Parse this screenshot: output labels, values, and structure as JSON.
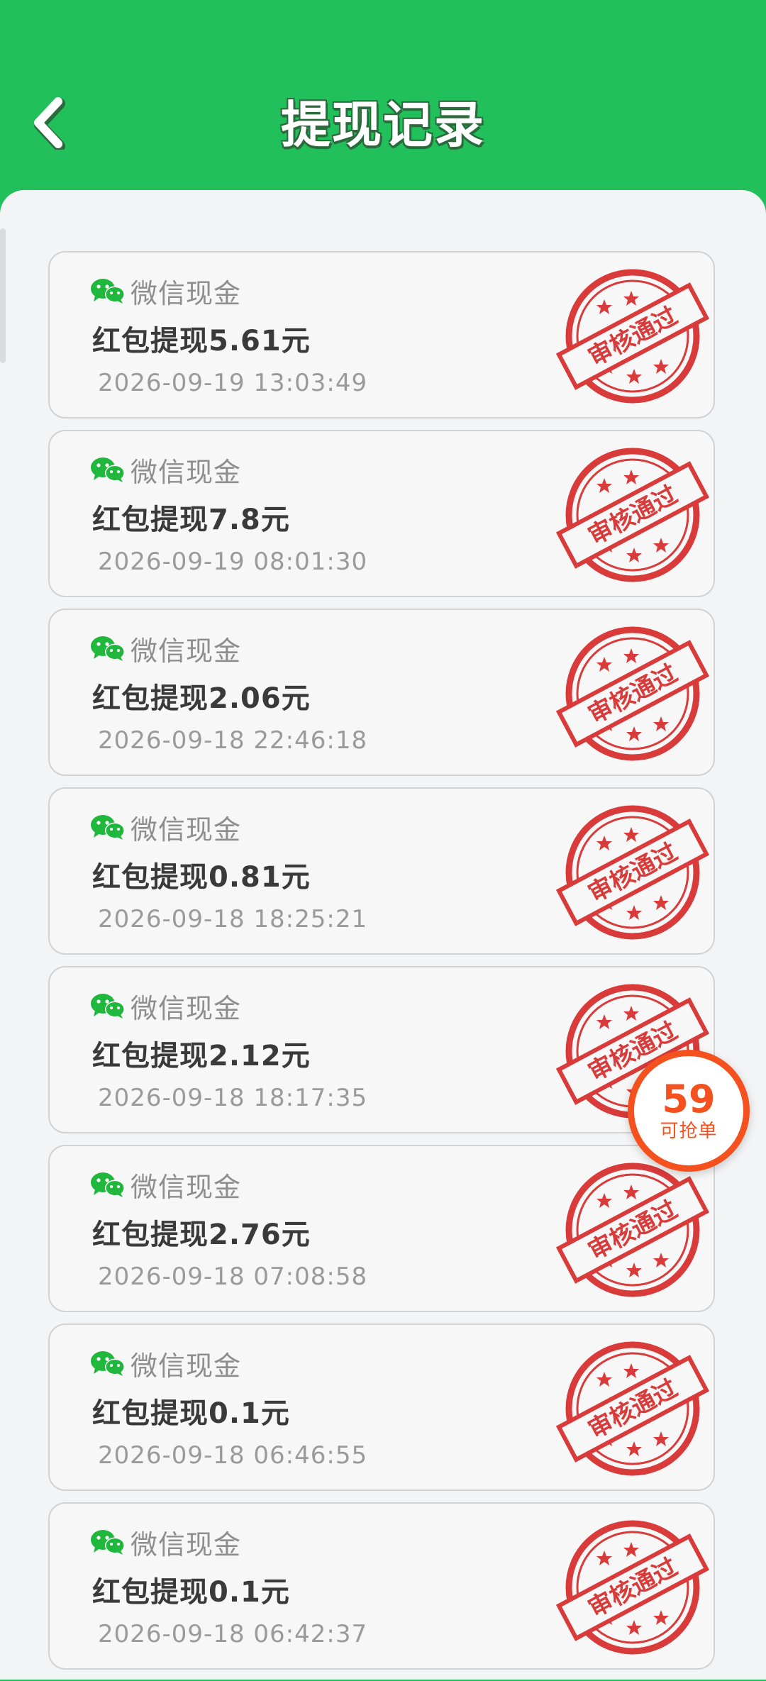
{
  "header": {
    "title": "提现记录",
    "back_icon": "chevron-left-icon"
  },
  "colors": {
    "header_bg": "#21c05b",
    "stamp_red": "#d93a3a",
    "wechat_green": "#1fb83d",
    "badge_orange": "#f4511e"
  },
  "records": [
    {
      "source": "微信现金",
      "title": "红包提现5.61元",
      "time": "2026-09-19 13:03:49",
      "stamp": "审核通过"
    },
    {
      "source": "微信现金",
      "title": "红包提现7.8元",
      "time": "2026-09-19 08:01:30",
      "stamp": "审核通过"
    },
    {
      "source": "微信现金",
      "title": "红包提现2.06元",
      "time": "2026-09-18 22:46:18",
      "stamp": "审核通过"
    },
    {
      "source": "微信现金",
      "title": "红包提现0.81元",
      "time": "2026-09-18 18:25:21",
      "stamp": "审核通过"
    },
    {
      "source": "微信现金",
      "title": "红包提现2.12元",
      "time": "2026-09-18 18:17:35",
      "stamp": "审核通过"
    },
    {
      "source": "微信现金",
      "title": "红包提现2.76元",
      "time": "2026-09-18 07:08:58",
      "stamp": "审核通过"
    },
    {
      "source": "微信现金",
      "title": "红包提现0.1元",
      "time": "2026-09-18 06:46:55",
      "stamp": "审核通过"
    },
    {
      "source": "微信现金",
      "title": "红包提现0.1元",
      "time": "2026-09-18 06:42:37",
      "stamp": "审核通过"
    }
  ],
  "float_badge": {
    "count": "59",
    "label": "可抢单"
  }
}
